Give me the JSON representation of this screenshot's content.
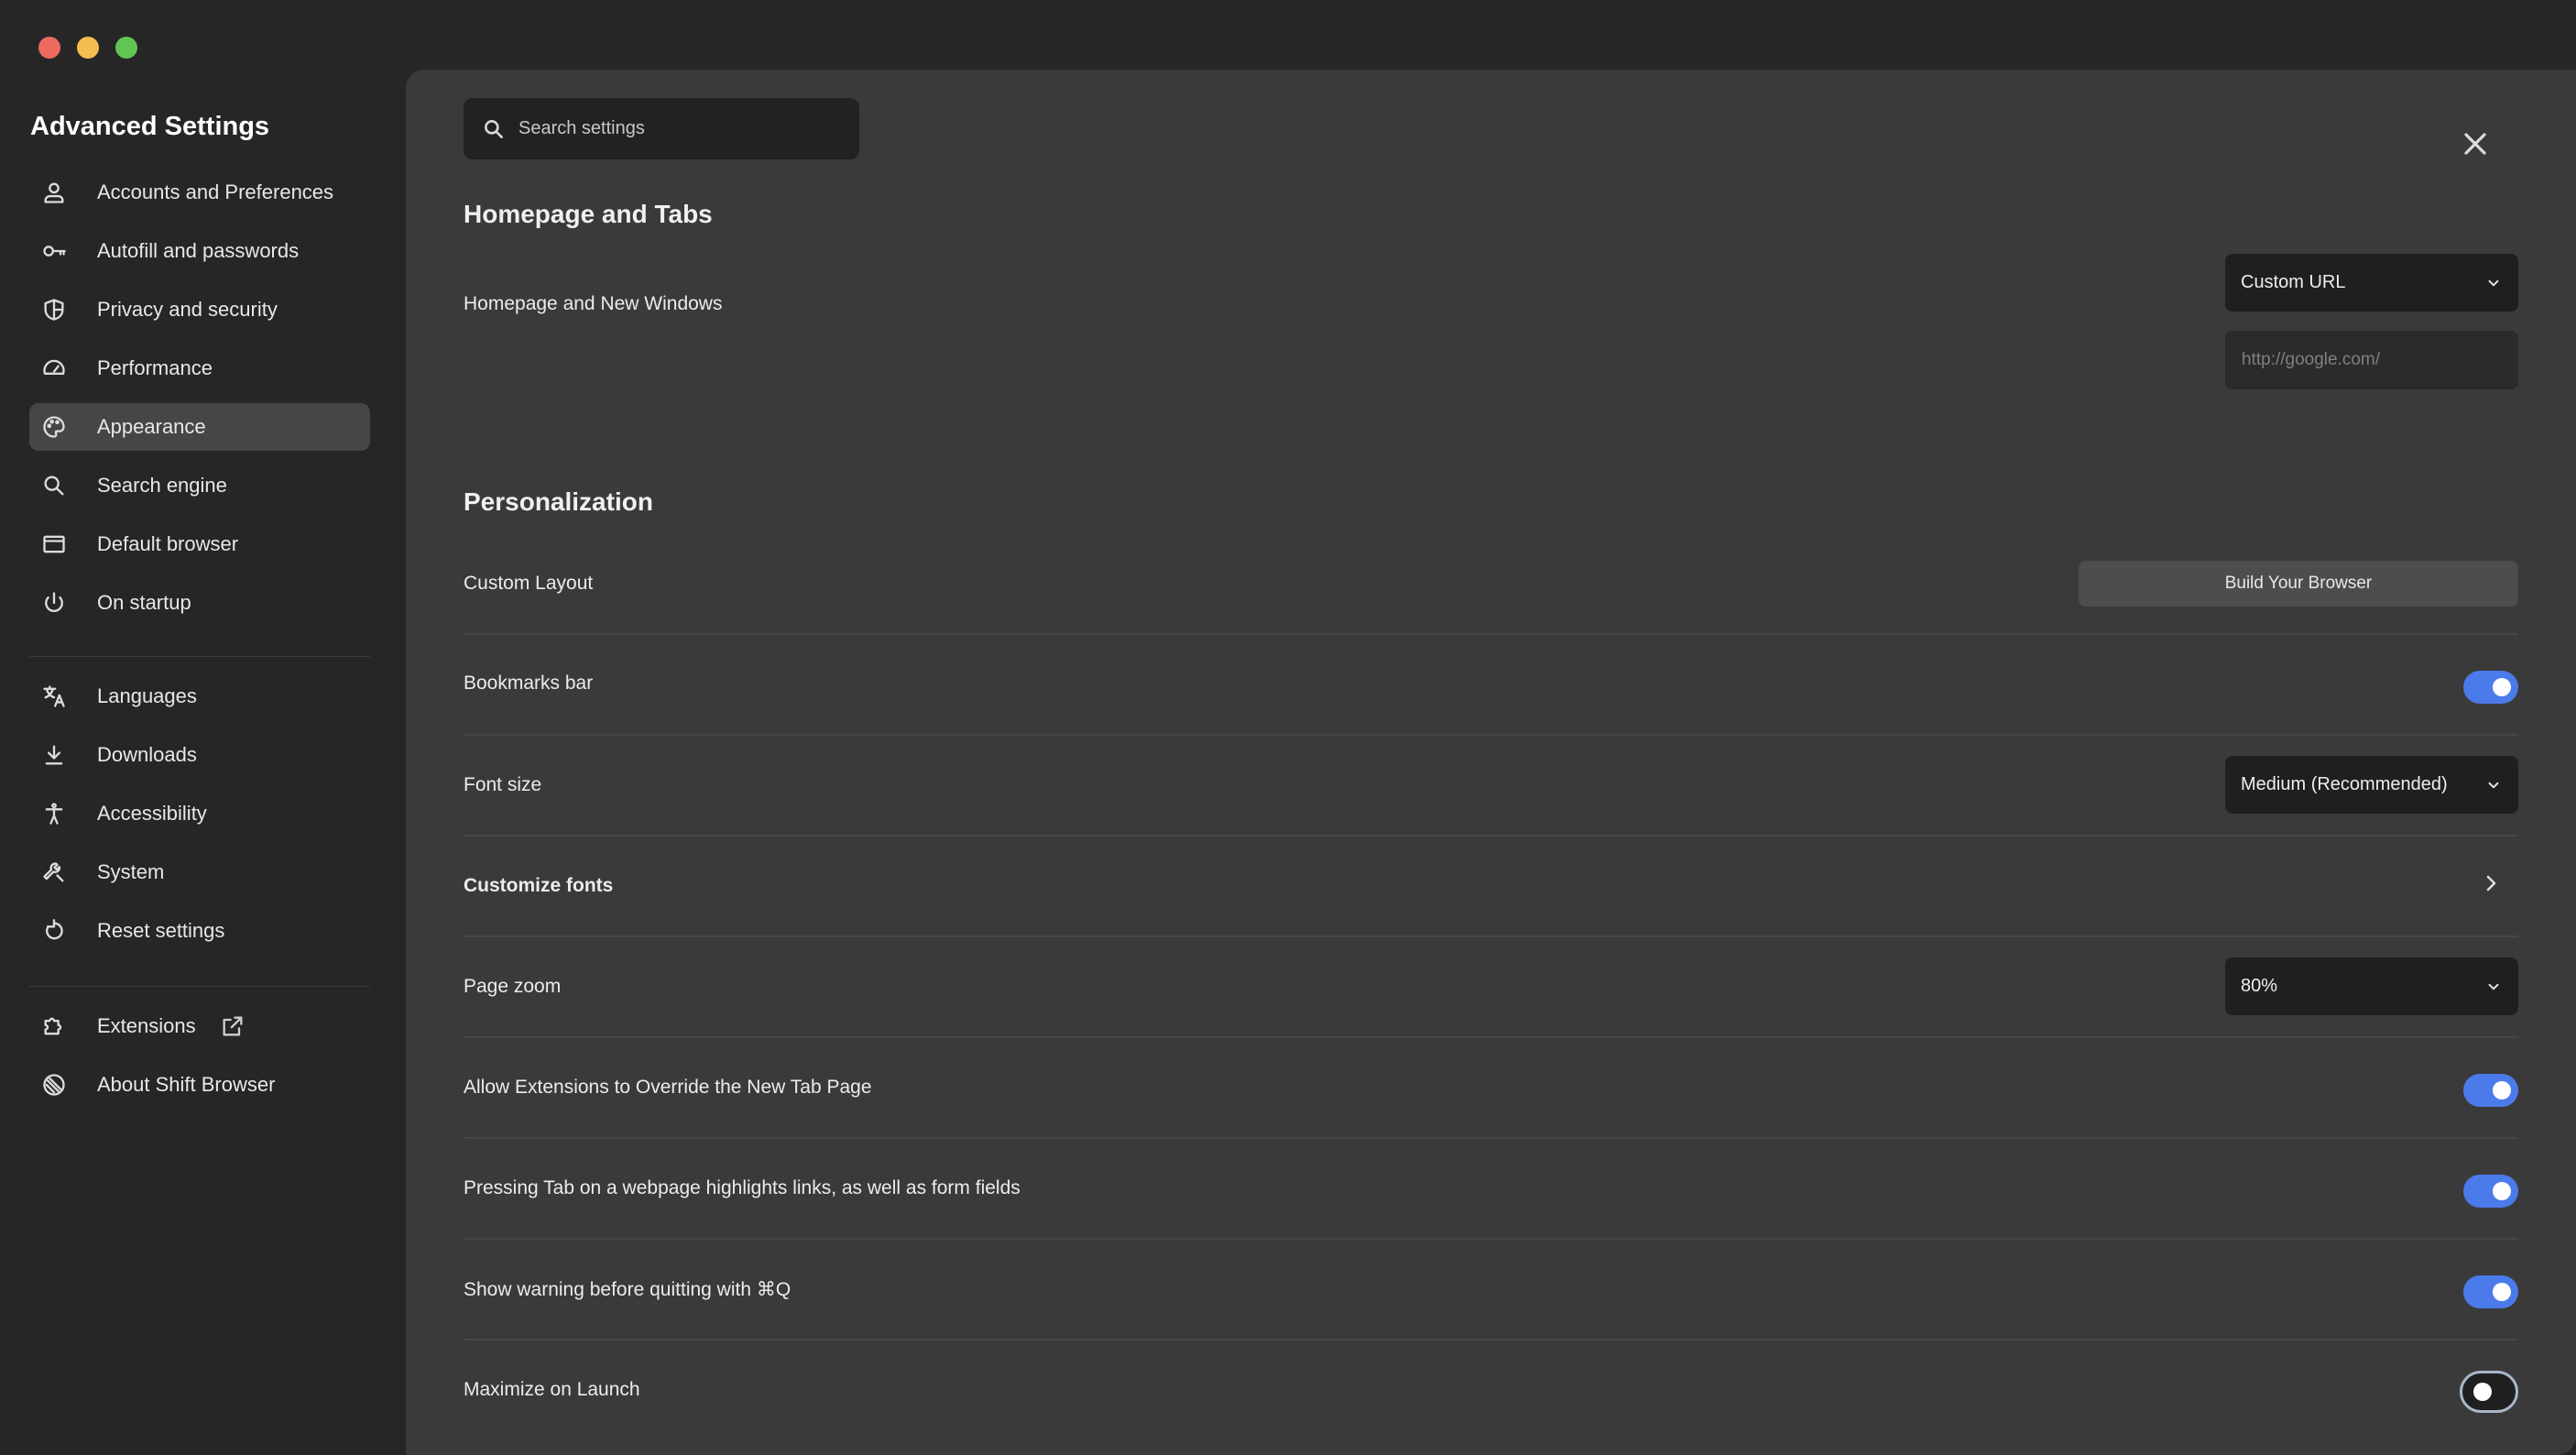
{
  "sidebar": {
    "title": "Advanced Settings",
    "group1": [
      {
        "label": "Accounts and Preferences",
        "icon": "person-icon"
      },
      {
        "label": "Autofill and passwords",
        "icon": "key-icon"
      },
      {
        "label": "Privacy and security",
        "icon": "shield-icon"
      },
      {
        "label": "Performance",
        "icon": "gauge-icon"
      },
      {
        "label": "Appearance",
        "icon": "palette-icon",
        "active": true
      },
      {
        "label": "Search engine",
        "icon": "search-icon"
      },
      {
        "label": "Default browser",
        "icon": "browser-window-icon"
      },
      {
        "label": "On startup",
        "icon": "power-icon"
      }
    ],
    "group2": [
      {
        "label": "Languages",
        "icon": "translate-icon"
      },
      {
        "label": "Downloads",
        "icon": "download-icon"
      },
      {
        "label": "Accessibility",
        "icon": "accessibility-icon"
      },
      {
        "label": "System",
        "icon": "wrench-icon"
      },
      {
        "label": "Reset settings",
        "icon": "reset-icon"
      }
    ],
    "group3": [
      {
        "label": "Extensions",
        "icon": "puzzle-icon"
      },
      {
        "label": "About Shift Browser",
        "icon": "shift-logo-icon"
      }
    ]
  },
  "search": {
    "placeholder": "Search settings"
  },
  "homepage": {
    "title": "Homepage and Tabs",
    "row_label": "Homepage and New Windows",
    "select_value": "Custom URL",
    "url_placeholder": "http://google.com/"
  },
  "personalization": {
    "title": "Personalization",
    "custom_layout_label": "Custom Layout",
    "build_button": "Build Your Browser",
    "bookmarks_label": "Bookmarks bar",
    "bookmarks_on": true,
    "font_size_label": "Font size",
    "font_size_value": "Medium (Recommended)",
    "customize_fonts_label": "Customize fonts",
    "page_zoom_label": "Page zoom",
    "page_zoom_value": "80%",
    "allow_ext_label": "Allow Extensions to Override the New Tab Page",
    "allow_ext_on": true,
    "tab_highlight_label": "Pressing Tab on a webpage highlights links, as well as form fields",
    "tab_highlight_on": true,
    "quit_warning_label": "Show warning before quitting with ⌘Q",
    "quit_warning_on": true,
    "maximize_label": "Maximize on Launch",
    "maximize_on": false
  },
  "colors": {
    "accent": "#4b7bea",
    "active_nav": "#464646"
  }
}
